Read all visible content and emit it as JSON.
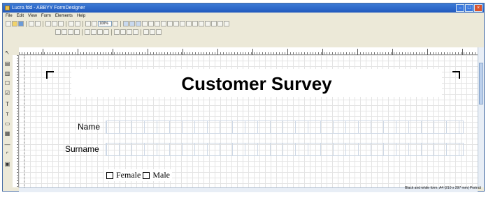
{
  "window": {
    "title": "Lucro.fdd - ABBYY FormDesigner"
  },
  "menu": [
    "File",
    "Edit",
    "View",
    "Form",
    "Elements",
    "Help"
  ],
  "toolbar": {
    "zoom_value": "100%"
  },
  "form": {
    "title": "Customer Survey",
    "fields": [
      {
        "label": "Name"
      },
      {
        "label": "Surname"
      }
    ],
    "checkboxes": [
      {
        "label": "Female",
        "checked": false
      },
      {
        "label": "Male",
        "checked": false
      }
    ]
  },
  "status": {
    "text": "Black and white form, A4 (210 x 297 mm) Portrait"
  },
  "icons": {
    "palette": [
      "pointer-icon",
      "text-field-icon",
      "comb-field-icon",
      "checkbox-icon",
      "text-tool-icon",
      "line-tool-icon",
      "barcode-icon",
      "image-icon",
      "corner-mark-icon",
      "table-icon"
    ]
  },
  "colors": {
    "title_bar": "#2159bd",
    "chrome": "#ece9d8",
    "grid": "#e4e4e4",
    "field_border": "#cfd9e6"
  }
}
